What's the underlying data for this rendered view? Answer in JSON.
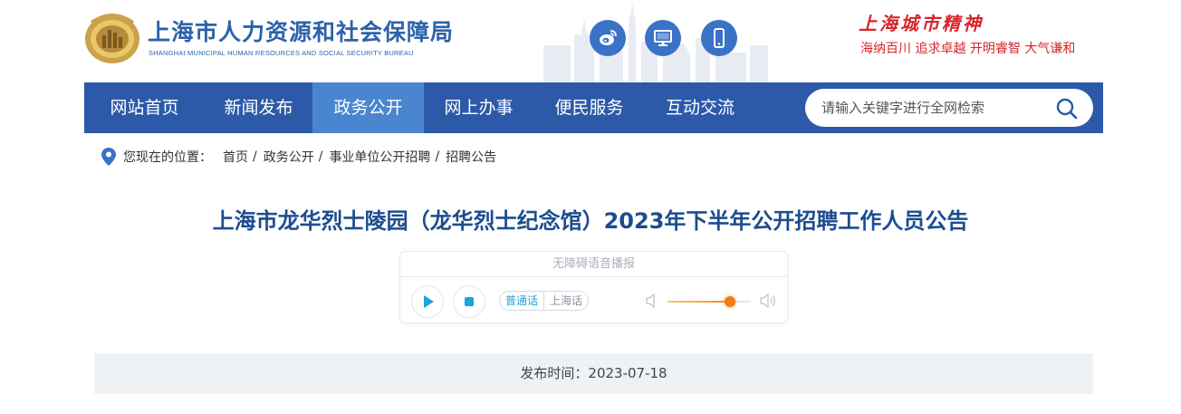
{
  "header": {
    "org_name": "上海市人力资源和社会保障局",
    "org_name_en": "SHANGHAI MUNICIPAL HUMAN RESOURCES AND SOCIAL SECURITY BUREAU",
    "spirit_title": "上海城市精神",
    "spirit_motto": "海纳百川  追求卓越  开明睿智  大气谦和",
    "icons": [
      "weibo-icon",
      "desktop-icon",
      "mobile-icon"
    ]
  },
  "nav": {
    "items": [
      {
        "label": "网站首页"
      },
      {
        "label": "新闻发布"
      },
      {
        "label": "政务公开",
        "active": true
      },
      {
        "label": "网上办事"
      },
      {
        "label": "便民服务"
      },
      {
        "label": "互动交流"
      }
    ],
    "search_placeholder": "请输入关键字进行全网检索"
  },
  "breadcrumb": {
    "label": "您现在的位置：",
    "items": [
      "首页",
      "政务公开",
      "事业单位公开招聘",
      "招聘公告"
    ]
  },
  "article": {
    "title": "上海市龙华烈士陵园（龙华烈士纪念馆）2023年下半年公开招聘工作人员公告",
    "publish_time": "发布时间：2023-07-18"
  },
  "player": {
    "title": "无障碍语音播报",
    "lang_options": [
      "普通话",
      "上海话"
    ],
    "selected_lang": "普通话",
    "volume": 0.75
  },
  "colors": {
    "nav_bg": "#2c5aa8",
    "nav_active": "#4a86cf",
    "title": "#1c4d8f",
    "spirit_red": "#d7262b",
    "brand_blue": "#2c62ac"
  }
}
